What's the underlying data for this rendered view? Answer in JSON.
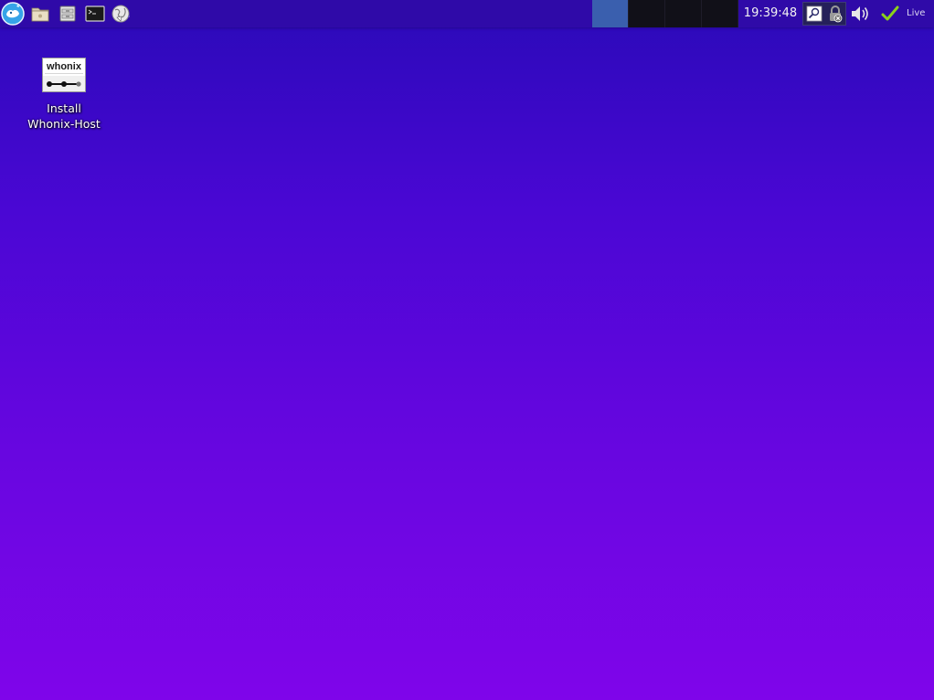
{
  "panel": {
    "launchers": [
      {
        "name": "app-menu-icon"
      },
      {
        "name": "file-manager-icon"
      },
      {
        "name": "file-cabinet-icon"
      },
      {
        "name": "terminal-icon"
      },
      {
        "name": "web-browser-icon"
      }
    ],
    "clock": "19:39:48",
    "live_label": "Live"
  },
  "desktop": {
    "icon": {
      "thumb_text": "whonix",
      "label_line1": "Install",
      "label_line2": "Whonix-Host"
    }
  },
  "colors": {
    "panel": "#2f0aa8",
    "gradient_top": "#2a0ab8",
    "gradient_bottom": "#7f05ea",
    "active_workspace": "#3a5fae",
    "check_green": "#8bd11a"
  }
}
